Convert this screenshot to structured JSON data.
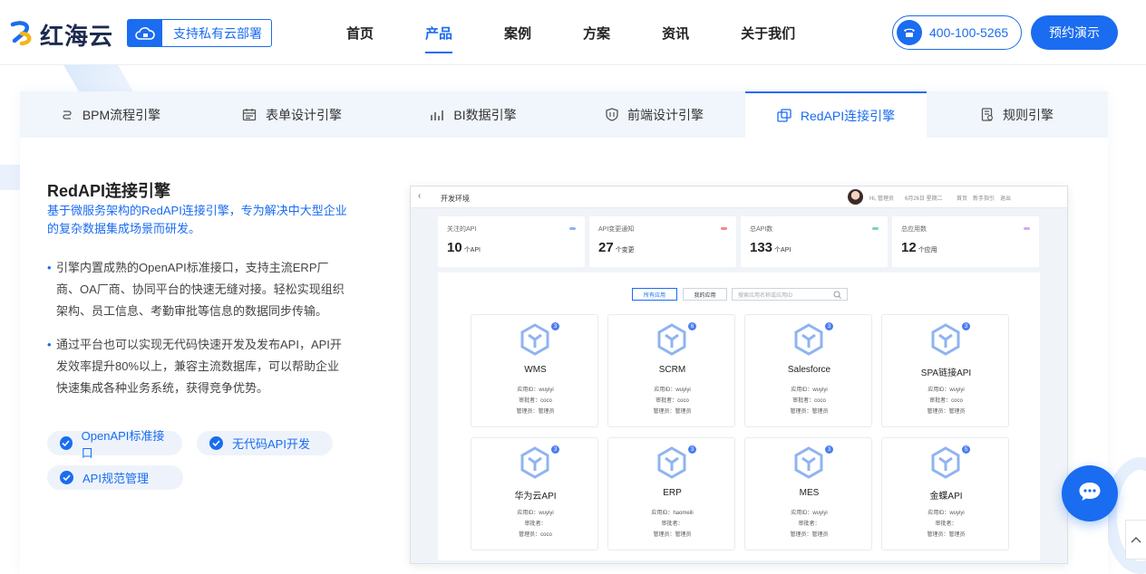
{
  "header": {
    "logo_text": "红海云",
    "private_badge": "支持私有云部署",
    "nav": [
      "首页",
      "产品",
      "案例",
      "方案",
      "资讯",
      "关于我们"
    ],
    "active_nav": "产品",
    "phone": "400-100-5265",
    "demo_button": "预约演示",
    "brand_color": "#1a6cf0"
  },
  "tabs": [
    {
      "label": "BPM流程引擎",
      "icon": "flow-icon"
    },
    {
      "label": "表单设计引擎",
      "icon": "calendar-form-icon"
    },
    {
      "label": "BI数据引擎",
      "icon": "bar-chart-icon"
    },
    {
      "label": "前端设计引擎",
      "icon": "shield-design-icon"
    },
    {
      "label": "RedAPI连接引擎",
      "icon": "link-window-icon",
      "active": true
    },
    {
      "label": "规则引擎",
      "icon": "rule-doc-icon"
    }
  ],
  "content": {
    "title": "RedAPI连接引擎",
    "subtitle": "基于微服务架构的RedAPI连接引擎，专为解决中大型企业的复杂数据集成场景而研发。",
    "bullets": [
      "引擎内置成熟的OpenAPI标准接口，支持主流ERP厂商、OA厂商、协同平台的快速无缝对接。轻松实现组织架构、员工信息、考勤审批等信息的数据同步传输。",
      "通过平台也可以实现无代码快速开发及发布API，API开发效率提升80%以上，兼容主流数据库，可以帮助企业快速集成各种业务系统，获得竞争优势。"
    ],
    "chips": [
      "OpenAPI标准接口",
      "无代码API开发",
      "API规范管理"
    ]
  },
  "mock": {
    "back": "‹",
    "env": "开发环境",
    "greeting": "Hi, 管理员",
    "date": "6月26日 星期二",
    "links": [
      "首页",
      "新手指引",
      "退出"
    ],
    "stats": [
      {
        "label": "关注的API",
        "value": "10",
        "unit": "个API",
        "color": "#8fb4f5"
      },
      {
        "label": "API变更通知",
        "value": "27",
        "unit": "个变更",
        "color": "#f08a8a"
      },
      {
        "label": "总API数",
        "value": "133",
        "unit": "个API",
        "color": "#7fd4b0"
      },
      {
        "label": "总应用数",
        "value": "12",
        "unit": "个应用",
        "color": "#d9a6f0"
      }
    ],
    "filter": {
      "all": "所有应用",
      "mine": "我的应用",
      "search_placeholder": "搜索应用名称或应用ID"
    },
    "apps": [
      {
        "name": "WMS",
        "badge": "3",
        "l1": "应用ID：wuyiyi",
        "l2": "审批者：coco",
        "l3": "管理员：管理员"
      },
      {
        "name": "SCRM",
        "badge": "6",
        "l1": "应用ID：wuyiyi",
        "l2": "审批者：coco",
        "l3": "管理员：管理员"
      },
      {
        "name": "Salesforce",
        "badge": "3",
        "l1": "应用ID：wuyiyi",
        "l2": "审批者：coco",
        "l3": "管理员：管理员"
      },
      {
        "name": "SPA链接API",
        "badge": "3",
        "l1": "应用ID：wuyiyi",
        "l2": "审批者：coco",
        "l3": "管理员：管理员"
      },
      {
        "name": "华为云API",
        "badge": "3",
        "l1": "应用ID：wuyiyi",
        "l2": "审批者：",
        "l3": "管理员：coco"
      },
      {
        "name": "ERP",
        "badge": "3",
        "l1": "应用ID：haomeili",
        "l2": "审批者：",
        "l3": "管理员：管理员"
      },
      {
        "name": "MES",
        "badge": "3",
        "l1": "应用ID：wuyiyi",
        "l2": "审批者：",
        "l3": "管理员：管理员"
      },
      {
        "name": "金蝶API",
        "badge": "5",
        "l1": "应用ID：wuyiyi",
        "l2": "审批者：",
        "l3": "管理员：管理员"
      }
    ]
  }
}
